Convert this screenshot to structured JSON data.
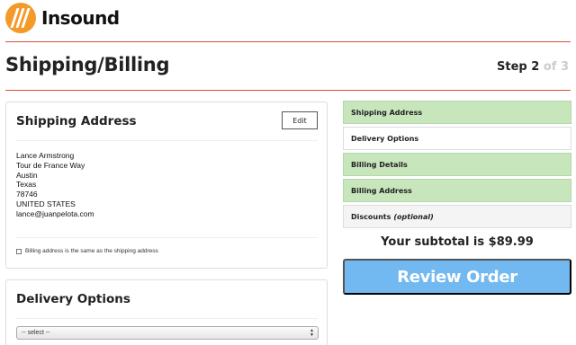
{
  "header": {
    "logo_text": "Insound",
    "brand_color": "#f39a2b",
    "rule_color": "#e0493c"
  },
  "page": {
    "title": "Shipping/Billing",
    "step_prefix": "Step 2",
    "step_suffix": "of 3"
  },
  "shipping": {
    "title": "Shipping Address",
    "edit_label": "Edit",
    "address_lines": [
      "Lance Armstrong",
      "Tour de France Way",
      "Austin",
      "Texas",
      "78746",
      "UNITED STATES",
      "lance@juanpelota.com"
    ],
    "same_as_shipping_label": "Billing address is the same as the shipping address",
    "same_as_shipping_checked": false
  },
  "delivery": {
    "title": "Delivery Options",
    "select_value": "-- select --"
  },
  "checkout_steps": [
    {
      "label": "Shipping Address",
      "state": "done"
    },
    {
      "label": "Delivery Options",
      "state": "current"
    },
    {
      "label": "Billing Details",
      "state": "done"
    },
    {
      "label": "Billing Address",
      "state": "done"
    },
    {
      "label": "Discounts",
      "optional_label": "(optional)",
      "state": "todo"
    }
  ],
  "summary": {
    "subtotal_text": "Your subtotal is $89.99",
    "review_button_label": "Review Order",
    "review_button_color": "#71b9f0",
    "done_step_color": "#c7e6bc"
  }
}
